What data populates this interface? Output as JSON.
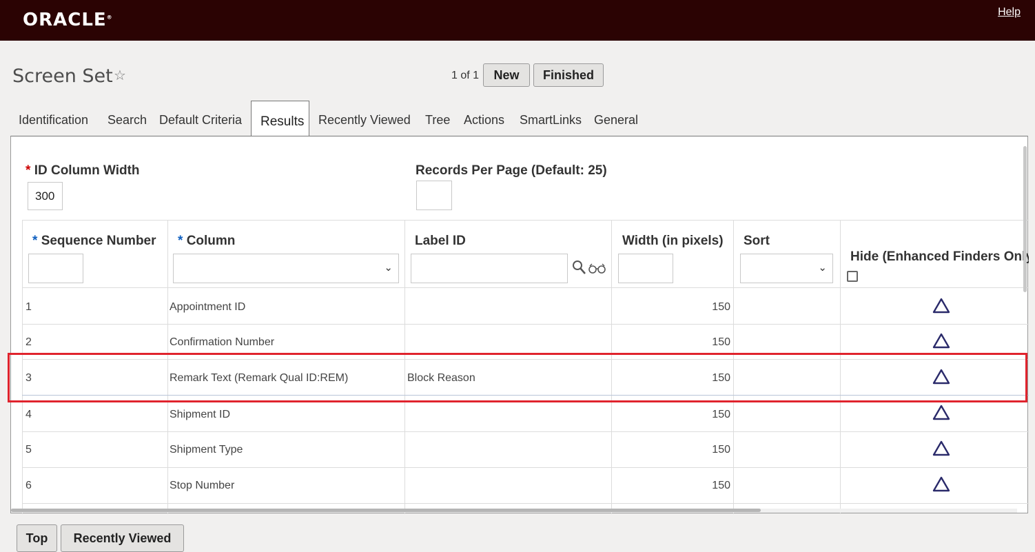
{
  "brand": {
    "logo": "ORACLE",
    "trademark": "®",
    "help": "Help"
  },
  "page": {
    "title": "Screen Set",
    "pager": "1 of 1",
    "new_label": "New",
    "finished_label": "Finished"
  },
  "tabs": [
    {
      "label": "Identification",
      "active": false
    },
    {
      "label": "Search",
      "active": false
    },
    {
      "label": "Default Criteria",
      "active": false
    },
    {
      "label": "Results",
      "active": true
    },
    {
      "label": "Recently Viewed",
      "active": false
    },
    {
      "label": "Tree",
      "active": false
    },
    {
      "label": "Actions",
      "active": false
    },
    {
      "label": "SmartLinks",
      "active": false
    },
    {
      "label": "General",
      "active": false
    }
  ],
  "form": {
    "required_mark": "*",
    "id_column_width_label": "ID Column Width",
    "id_column_width_value": "300",
    "records_per_page_label": "Records Per Page (Default: 25)",
    "records_per_page_value": ""
  },
  "grid": {
    "headers": {
      "sequence": "Sequence Number",
      "column": "Column",
      "label_id": "Label ID",
      "width": "Width (in pixels)",
      "sort": "Sort",
      "hide": "Hide (Enhanced Finders Only)"
    },
    "rows": [
      {
        "seq": "1",
        "column": "Appointment ID",
        "label_id": "",
        "width": "150",
        "sort": "",
        "hide_icon": "triangle-up-icon"
      },
      {
        "seq": "2",
        "column": "Confirmation Number",
        "label_id": "",
        "width": "150",
        "sort": "",
        "hide_icon": "triangle-up-icon"
      },
      {
        "seq": "3",
        "column": "Remark Text (Remark Qual ID:REM)",
        "label_id": "Block Reason",
        "width": "150",
        "sort": "",
        "hide_icon": "triangle-up-icon",
        "highlighted": true
      },
      {
        "seq": "4",
        "column": "Shipment ID",
        "label_id": "",
        "width": "150",
        "sort": "",
        "hide_icon": "triangle-up-icon"
      },
      {
        "seq": "5",
        "column": "Shipment Type",
        "label_id": "",
        "width": "150",
        "sort": "",
        "hide_icon": "triangle-up-icon"
      },
      {
        "seq": "6",
        "column": "Stop Number",
        "label_id": "",
        "width": "150",
        "sort": "",
        "hide_icon": "triangle-up-icon"
      }
    ]
  },
  "footer": {
    "top_label": "Top",
    "recently_viewed_label": "Recently Viewed"
  },
  "colors": {
    "header_bg": "#2b0303",
    "highlight": "#e0232d",
    "icon": "#2a2a6a"
  }
}
